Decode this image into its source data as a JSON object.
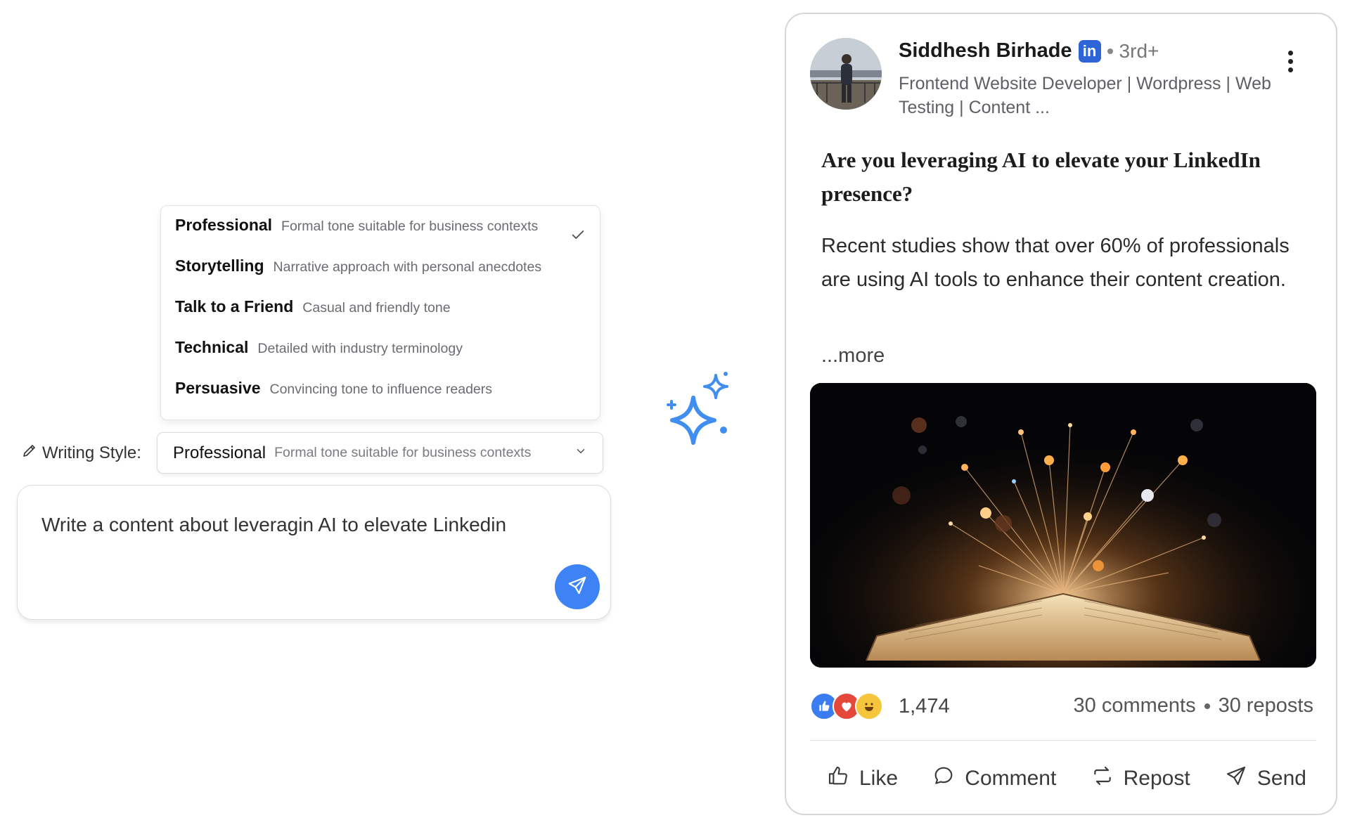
{
  "writing_style": {
    "label": "Writing Style:",
    "selected": {
      "label": "Professional",
      "description": "Formal tone suitable for business contexts"
    },
    "options": [
      {
        "label": "Professional",
        "description": "Formal tone suitable for business contexts",
        "selected": true
      },
      {
        "label": "Storytelling",
        "description": "Narrative approach with personal anecdotes",
        "selected": false
      },
      {
        "label": "Talk to a Friend",
        "description": "Casual and friendly tone",
        "selected": false
      },
      {
        "label": "Technical",
        "description": "Detailed with industry terminology",
        "selected": false
      },
      {
        "label": "Persuasive",
        "description": "Convincing tone to influence readers",
        "selected": false
      }
    ]
  },
  "prompt": {
    "text": "Write a content about leveragin AI to elevate Linkedin",
    "send_icon": "send-icon"
  },
  "post": {
    "author": {
      "name": "Siddhesh Birhade",
      "badge": "in",
      "degree": "3rd+",
      "headline": "Frontend Website Developer | Wordpress | Web Testing | Content ..."
    },
    "title": "Are you leveraging AI to elevate your LinkedIn presence?",
    "body": "Recent studies show that over 60% of professionals are using AI tools to enhance their content creation.",
    "more": "...more",
    "reaction_count": "1,474",
    "comments": "30 comments",
    "reposts": "30 reposts",
    "actions": {
      "like": "Like",
      "comment": "Comment",
      "repost": "Repost",
      "send": "Send"
    }
  },
  "colors": {
    "accent_blue": "#3d83f5",
    "linkedin_blue": "#2d64d8",
    "sparkle_blue": "#3f8ef0"
  }
}
